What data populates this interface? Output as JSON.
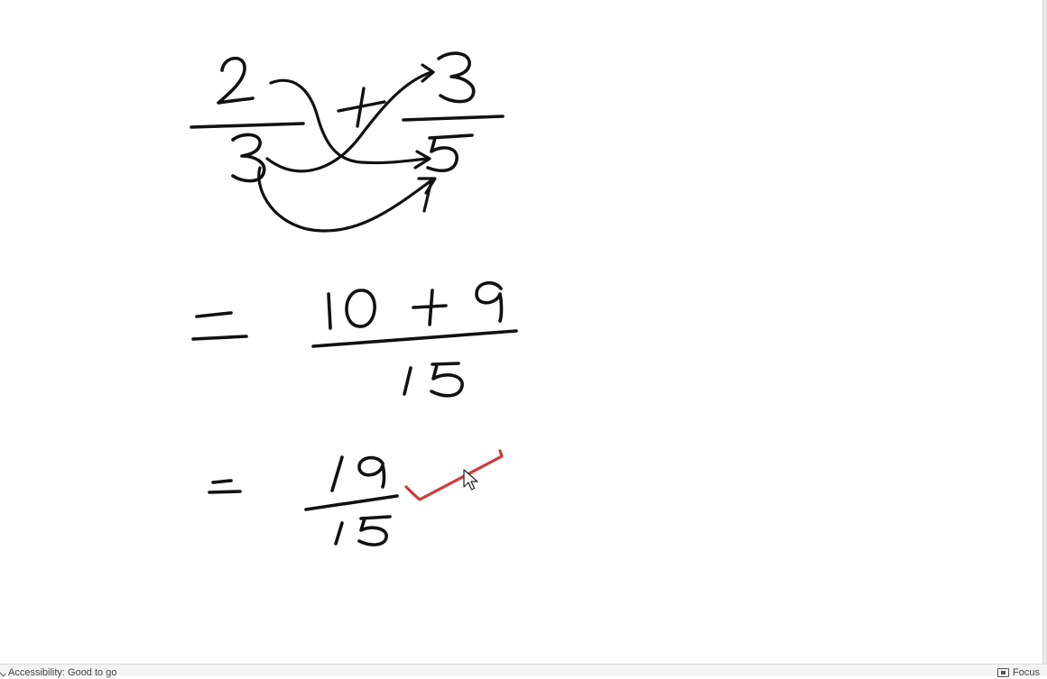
{
  "canvas": {
    "background": "#ffffff",
    "ink_color": "#111111",
    "check_color": "#d23a3a"
  },
  "ink_content": {
    "problem": "2/3 + 3/5",
    "step_1": "= (10 + 9) / 15",
    "step_2": "= 19/15"
  },
  "icons": {
    "accessibility": "accessibility-check-icon",
    "focus": "focus-mode-icon",
    "pointer": "mouse-pointer-icon",
    "checkmark": "red-checkmark-icon"
  },
  "status_bar": {
    "accessibility_text": "Accessibility: Good to go",
    "focus_label": "Focus"
  }
}
